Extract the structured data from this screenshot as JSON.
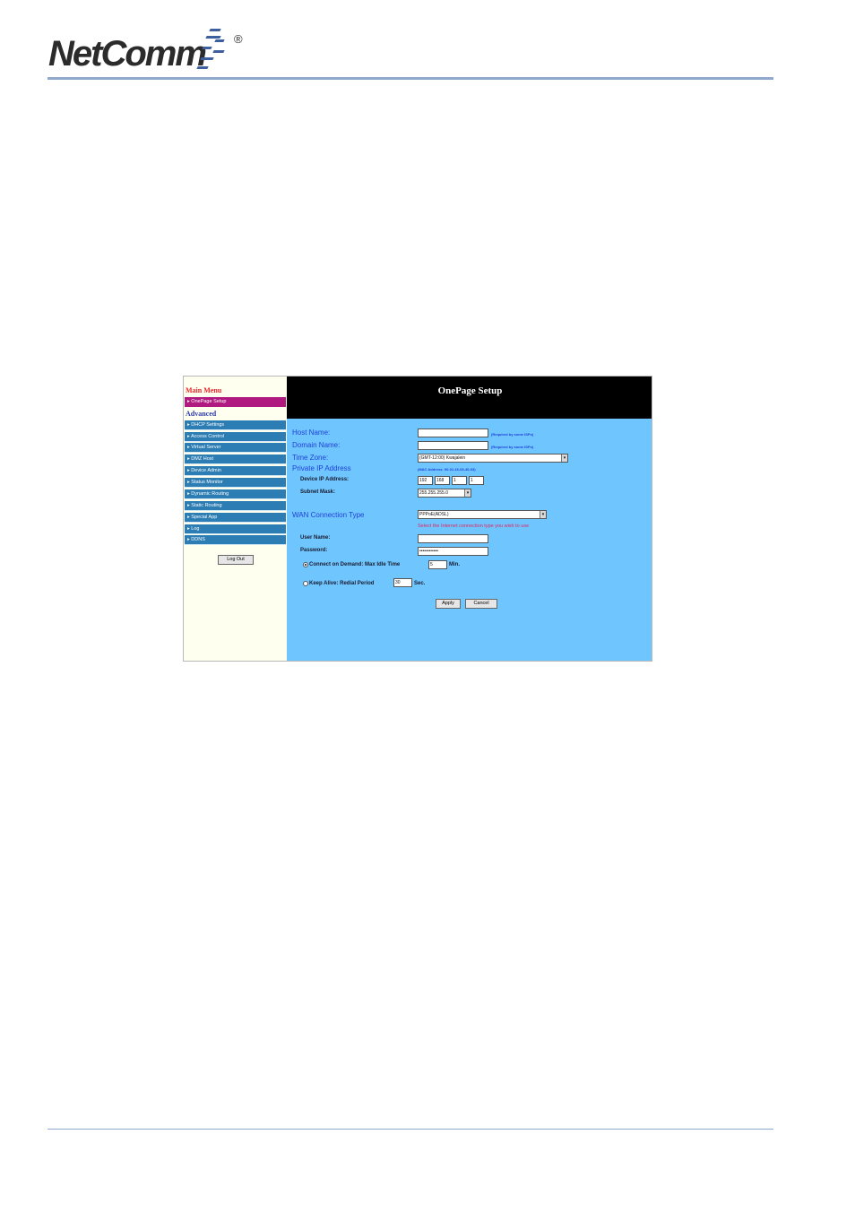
{
  "brand": {
    "logo_text": "NetComm",
    "registered": "®",
    "accent": "#3d5f9e"
  },
  "sidebar": {
    "main_menu": "Main Menu",
    "active_item": "OnePage Setup",
    "advanced": "Advanced",
    "items": [
      "DHCP Settings",
      "Access Control",
      "Virtual Server",
      "DMZ Host",
      "Device Admin",
      "Status Monitor",
      "Dynamic Routing",
      "Static Routing",
      "Special App",
      "Log",
      "DDNS"
    ],
    "logout": "Log Out"
  },
  "page": {
    "title": "OnePage Setup"
  },
  "form": {
    "host_name_label": "Host Name:",
    "host_name_value": "",
    "host_name_note": "(Required by some ISPs)",
    "domain_name_label": "Domain Name:",
    "domain_name_value": "",
    "domain_name_note": "(Required by some ISPs)",
    "time_zone_label": "Time Zone:",
    "time_zone_value": "(GMT-12:00) Kwajalein",
    "private_ip_label": "Private IP Address",
    "mac_note": "(MAC Address: 00-01-16-03-40-03)",
    "device_ip_label": "Device IP Address:",
    "ip": [
      "192",
      "168",
      "1",
      "1"
    ],
    "subnet_label": "Subnet Mask:",
    "subnet_value": "255.255.255.0",
    "wan_label": "WAN Connection Type",
    "wan_value": "PPPoE(ADSL)",
    "wan_hint": "Select the Internet connection type you wish to use",
    "user_name_label": "User Name:",
    "user_name_value": "",
    "password_label": "Password:",
    "password_value": "••••••••••••",
    "connect_on_demand_label": "Connect on Demand: Max Idle Time",
    "idle_time_value": "5",
    "idle_unit": "Min.",
    "keep_alive_label": "Keep Alive: Redial Period",
    "redial_value": "30",
    "redial_unit": "Sec.",
    "apply": "Apply",
    "cancel": "Cancel"
  }
}
